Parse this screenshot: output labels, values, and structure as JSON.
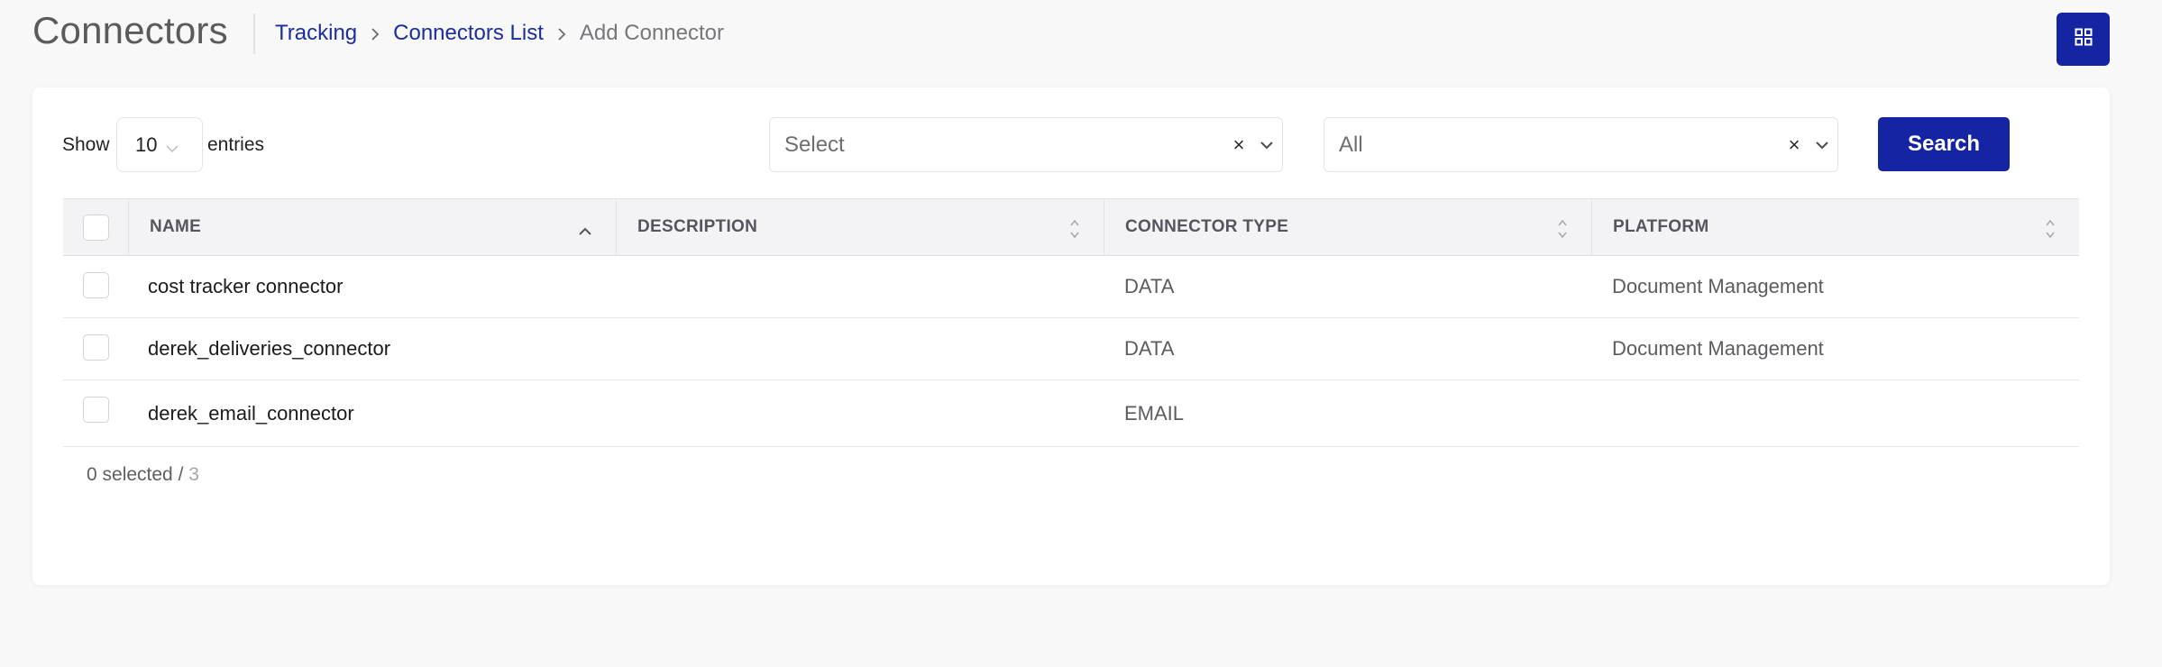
{
  "header": {
    "title": "Connectors",
    "breadcrumbs": [
      {
        "label": "Tracking"
      },
      {
        "label": "Connectors List"
      },
      {
        "label": "Add Connector"
      }
    ],
    "grid_icon": "grid-icon"
  },
  "controls": {
    "show_label": "Show",
    "entries_value": "10",
    "entries_label": "entries",
    "filter1_placeholder": "Select",
    "filter2_value": "All",
    "clear_glyph": "×",
    "search_label": "Search"
  },
  "table": {
    "columns": [
      "NAME",
      "DESCRIPTION",
      "CONNECTOR TYPE",
      "PLATFORM"
    ],
    "rows": [
      {
        "name": "cost tracker connector",
        "description": "",
        "type": "DATA",
        "platform": "Document Management"
      },
      {
        "name": "derek_deliveries_connector",
        "description": "",
        "type": "DATA",
        "platform": "Document Management"
      },
      {
        "name": "derek_email_connector",
        "description": "",
        "type": "EMAIL",
        "platform": ""
      }
    ]
  },
  "footer": {
    "selected_text": "0 selected /",
    "total": "3"
  },
  "colors": {
    "accent": "#1524a3",
    "link": "#1a2ea0",
    "background": "#f8f8f8"
  }
}
